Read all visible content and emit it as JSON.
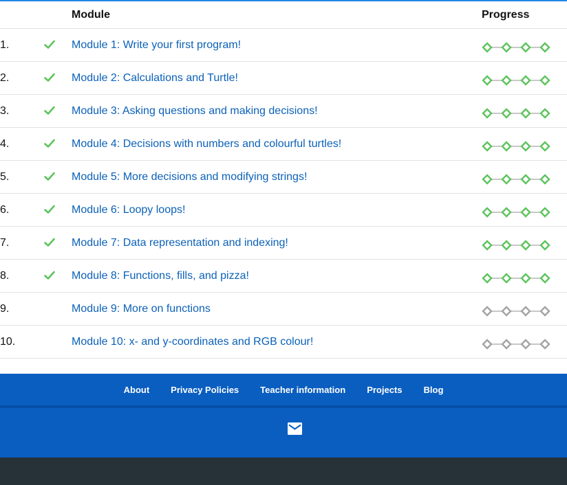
{
  "table": {
    "header": {
      "module": "Module",
      "progress": "Progress"
    },
    "rows": [
      {
        "num": "1.",
        "completed": true,
        "title": "Module 1: Write your first program!",
        "progress_filled": 4,
        "progress_total": 4
      },
      {
        "num": "2.",
        "completed": true,
        "title": "Module 2: Calculations and Turtle!",
        "progress_filled": 4,
        "progress_total": 4
      },
      {
        "num": "3.",
        "completed": true,
        "title": "Module 3: Asking questions and making decisions!",
        "progress_filled": 4,
        "progress_total": 4
      },
      {
        "num": "4.",
        "completed": true,
        "title": "Module 4: Decisions with numbers and colourful turtles!",
        "progress_filled": 4,
        "progress_total": 4
      },
      {
        "num": "5.",
        "completed": true,
        "title": "Module 5: More decisions and modifying strings!",
        "progress_filled": 4,
        "progress_total": 4
      },
      {
        "num": "6.",
        "completed": true,
        "title": "Module 6: Loopy loops!",
        "progress_filled": 4,
        "progress_total": 4
      },
      {
        "num": "7.",
        "completed": true,
        "title": "Module 7: Data representation and indexing!",
        "progress_filled": 4,
        "progress_total": 4
      },
      {
        "num": "8.",
        "completed": true,
        "title": "Module 8: Functions, fills, and pizza!",
        "progress_filled": 4,
        "progress_total": 4
      },
      {
        "num": "9.",
        "completed": false,
        "title": "Module 9: More on functions",
        "progress_filled": 0,
        "progress_total": 4
      },
      {
        "num": "10.",
        "completed": false,
        "title": "Module 10: x- and y-coordinates and RGB colour!",
        "progress_filled": 0,
        "progress_total": 4
      }
    ]
  },
  "footer": {
    "links": [
      "About",
      "Privacy Policies",
      "Teacher information",
      "Projects",
      "Blog"
    ],
    "contact_icon": "mail-icon"
  },
  "colors": {
    "accent": "#1e88e5",
    "link": "#0b61b8",
    "complete_green": "#5cc45c",
    "incomplete_gray": "#a3a3a3",
    "footer_blue": "#0a5ec0",
    "footer_dark": "#263238"
  }
}
